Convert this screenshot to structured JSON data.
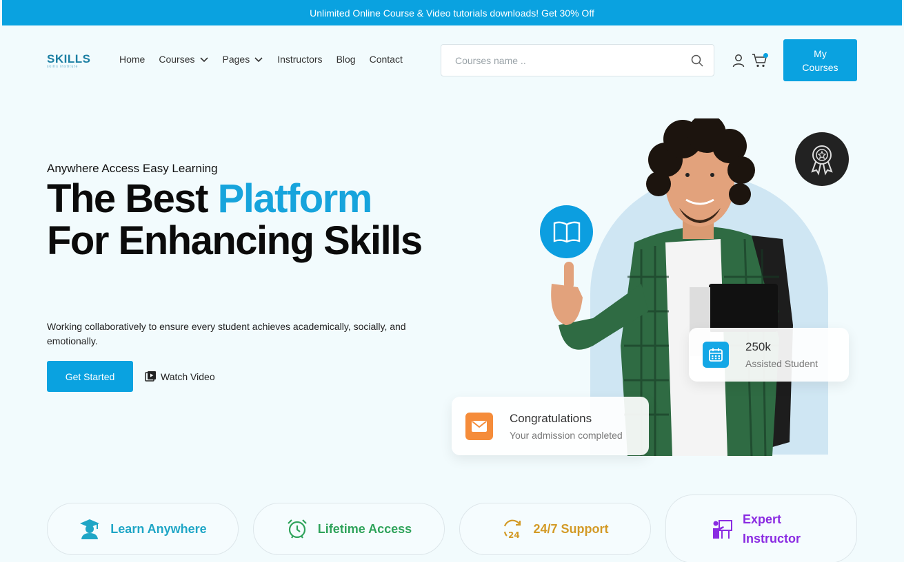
{
  "promo_bar": {
    "text": "Unlimited Online Course & Video tutorials downloads! Get 30% Off"
  },
  "header": {
    "logo": {
      "text": "SKILLS",
      "subtext": "skills institute"
    },
    "nav": [
      {
        "label": "Home",
        "has_dropdown": false
      },
      {
        "label": "Courses",
        "has_dropdown": true
      },
      {
        "label": "Pages",
        "has_dropdown": true
      },
      {
        "label": "Instructors",
        "has_dropdown": false
      },
      {
        "label": "Blog",
        "has_dropdown": false
      },
      {
        "label": "Contact",
        "has_dropdown": false
      }
    ],
    "search": {
      "placeholder": "Courses name ..",
      "value": "",
      "icon": "search-icon"
    },
    "icons": [
      "user-icon",
      "cart-icon"
    ],
    "cta": {
      "label": "My Courses"
    }
  },
  "hero": {
    "eyebrow": "Anywhere Access Easy Learning",
    "headline_part1": "The Best ",
    "headline_accent": "Platform",
    "headline_part2": "For Enhancing Skills",
    "description": "Working collaboratively to ensure every student achieves academically, socially, and emotionally.",
    "primary_button": "Get Started",
    "secondary_button": "Watch Video",
    "stats_card": {
      "value": "250k",
      "label": "Assisted Student",
      "icon": "calendar-icon"
    },
    "congrats_card": {
      "title": "Congratulations",
      "subtitle": "Your admission completed",
      "icon": "mail-icon"
    },
    "badges": [
      "book-icon",
      "award-icon"
    ]
  },
  "features": [
    {
      "label": "Learn Anywhere",
      "icon": "graduate-icon",
      "color": "#1fa6c6"
    },
    {
      "label": "Lifetime Access",
      "icon": "alarm-clock-icon",
      "color": "#2fa35b"
    },
    {
      "label": "24/7 Support",
      "icon": "support-24-icon",
      "color": "#d39a26"
    },
    {
      "label": "Expert Instructor",
      "icon": "instructor-icon",
      "color": "#8a2be2"
    }
  ],
  "colors": {
    "primary": "#0aa2e0",
    "accent_text": "#17a4dc",
    "background": "#f2fbfd"
  }
}
